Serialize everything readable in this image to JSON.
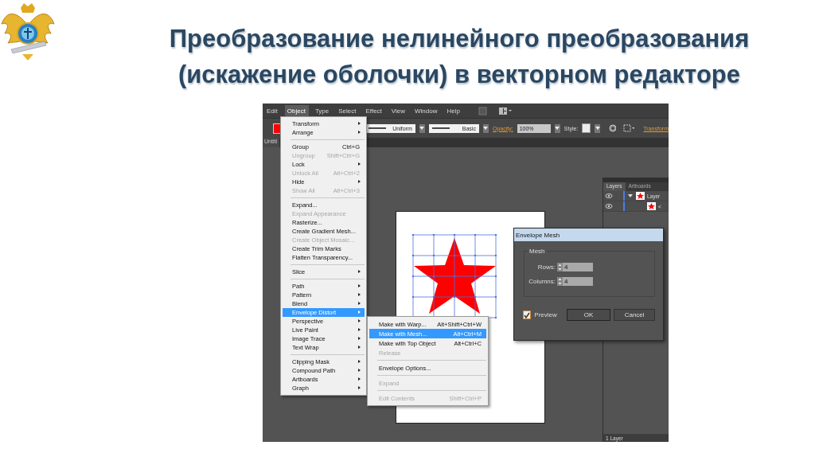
{
  "title_lines": [
    "Преобразование нелинейного преобразования",
    "(искажение оболочки) в векторном редакторе"
  ],
  "menubar": [
    {
      "label": "Edit",
      "selected": false
    },
    {
      "label": "Object",
      "selected": true
    },
    {
      "label": "Type",
      "selected": false
    },
    {
      "label": "Select",
      "selected": false
    },
    {
      "label": "Effect",
      "selected": false
    },
    {
      "label": "View",
      "selected": false
    },
    {
      "label": "Window",
      "selected": false
    },
    {
      "label": "Help",
      "selected": false
    }
  ],
  "control_bar": {
    "stroke_profile": "Uniform",
    "brush": "Basic",
    "opacity_label": "Opacity:",
    "opacity": "100%",
    "style_label": "Style:",
    "transform_link": "Transform"
  },
  "document_tab": "Untitl",
  "object_menu": [
    {
      "kind": "item",
      "label": "Transform",
      "submenu": true,
      "disabled": false,
      "selected": false
    },
    {
      "kind": "item",
      "label": "Arrange",
      "submenu": true,
      "disabled": false,
      "selected": false
    },
    {
      "kind": "separator"
    },
    {
      "kind": "item",
      "label": "Group",
      "shortcut": "Ctrl+G",
      "submenu": false,
      "disabled": false,
      "selected": false
    },
    {
      "kind": "item",
      "label": "Ungroup",
      "shortcut": "Shift+Ctrl+G",
      "submenu": false,
      "disabled": true,
      "selected": false
    },
    {
      "kind": "item",
      "label": "Lock",
      "submenu": true,
      "disabled": false,
      "selected": false
    },
    {
      "kind": "item",
      "label": "Unlock All",
      "shortcut": "Alt+Ctrl+2",
      "submenu": false,
      "disabled": true,
      "selected": false
    },
    {
      "kind": "item",
      "label": "Hide",
      "submenu": true,
      "disabled": false,
      "selected": false
    },
    {
      "kind": "item",
      "label": "Show All",
      "shortcut": "Alt+Ctrl+3",
      "submenu": false,
      "disabled": true,
      "selected": false
    },
    {
      "kind": "separator"
    },
    {
      "kind": "item",
      "label": "Expand...",
      "submenu": false,
      "disabled": false,
      "selected": false
    },
    {
      "kind": "item",
      "label": "Expand Appearance",
      "submenu": false,
      "disabled": true,
      "selected": false
    },
    {
      "kind": "item",
      "label": "Rasterize...",
      "submenu": false,
      "disabled": false,
      "selected": false
    },
    {
      "kind": "item",
      "label": "Create Gradient Mesh...",
      "submenu": false,
      "disabled": false,
      "selected": false
    },
    {
      "kind": "item",
      "label": "Create Object Mosaic...",
      "submenu": false,
      "disabled": true,
      "selected": false
    },
    {
      "kind": "item",
      "label": "Create Trim Marks",
      "submenu": false,
      "disabled": false,
      "selected": false
    },
    {
      "kind": "item",
      "label": "Flatten Transparency...",
      "submenu": false,
      "disabled": false,
      "selected": false
    },
    {
      "kind": "separator"
    },
    {
      "kind": "item",
      "label": "Slice",
      "submenu": true,
      "disabled": false,
      "selected": false
    },
    {
      "kind": "separator"
    },
    {
      "kind": "item",
      "label": "Path",
      "submenu": true,
      "disabled": false,
      "selected": false
    },
    {
      "kind": "item",
      "label": "Pattern",
      "submenu": true,
      "disabled": false,
      "selected": false
    },
    {
      "kind": "item",
      "label": "Blend",
      "submenu": true,
      "disabled": false,
      "selected": false
    },
    {
      "kind": "item",
      "label": "Envelope Distort",
      "submenu": true,
      "disabled": false,
      "selected": true
    },
    {
      "kind": "item",
      "label": "Perspective",
      "submenu": true,
      "disabled": false,
      "selected": false
    },
    {
      "kind": "item",
      "label": "Live Paint",
      "submenu": true,
      "disabled": false,
      "selected": false
    },
    {
      "kind": "item",
      "label": "Image Trace",
      "submenu": true,
      "disabled": false,
      "selected": false
    },
    {
      "kind": "item",
      "label": "Text Wrap",
      "submenu": true,
      "disabled": false,
      "selected": false
    },
    {
      "kind": "separator"
    },
    {
      "kind": "item",
      "label": "Clipping Mask",
      "submenu": true,
      "disabled": false,
      "selected": false
    },
    {
      "kind": "item",
      "label": "Compound Path",
      "submenu": true,
      "disabled": false,
      "selected": false
    },
    {
      "kind": "item",
      "label": "Artboards",
      "submenu": true,
      "disabled": false,
      "selected": false
    },
    {
      "kind": "item",
      "label": "Graph",
      "submenu": true,
      "disabled": false,
      "selected": false
    }
  ],
  "envelope_submenu": [
    {
      "kind": "item",
      "label": "Make with Warp...",
      "shortcut": "Alt+Shift+Ctrl+W",
      "disabled": false,
      "selected": false
    },
    {
      "kind": "item",
      "label": "Make with Mesh...",
      "shortcut": "Alt+Ctrl+M",
      "disabled": false,
      "selected": true
    },
    {
      "kind": "item",
      "label": "Make with Top Object",
      "shortcut": "Alt+Ctrl+C",
      "disabled": false,
      "selected": false
    },
    {
      "kind": "item",
      "label": "Release",
      "disabled": true,
      "selected": false
    },
    {
      "kind": "separator"
    },
    {
      "kind": "item",
      "label": "Envelope Options...",
      "disabled": false,
      "selected": false
    },
    {
      "kind": "separator"
    },
    {
      "kind": "item",
      "label": "Expand",
      "disabled": true,
      "selected": false
    },
    {
      "kind": "separator"
    },
    {
      "kind": "item",
      "label": "Edit Contents",
      "shortcut": "Shift+Ctrl+P",
      "disabled": true,
      "selected": false
    }
  ],
  "layers_panel": {
    "tabs": [
      {
        "label": "Layers",
        "selected": true
      },
      {
        "label": "Artboards",
        "selected": false
      }
    ],
    "rows": [
      {
        "name": "Layer",
        "expanded": true
      },
      {
        "name": "<"
      }
    ],
    "footer": "1 Layer"
  },
  "dialog": {
    "title": "Envelope Mesh",
    "group": "Mesh",
    "rows_label": "Rows:",
    "rows": "4",
    "columns_label": "Columns:",
    "columns": "4",
    "preview": {
      "label": "Preview",
      "checked": true
    },
    "ok": "OK",
    "cancel": "Cancel"
  }
}
